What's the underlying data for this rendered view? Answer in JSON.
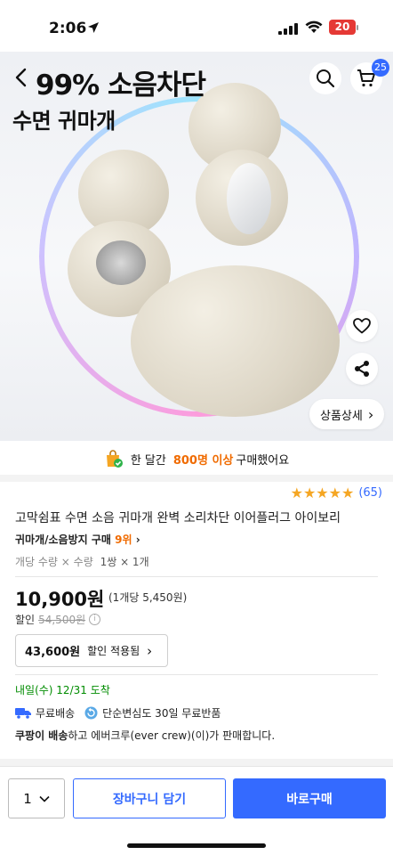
{
  "status_bar": {
    "time": "2:06",
    "battery": "20"
  },
  "hero": {
    "headline1": "99% 소음차단",
    "headline2": "수면 귀마개",
    "cart_count": "25",
    "detail_label": "상품상세",
    "detail_chevron": "›",
    "image_count": 8,
    "active_image_index": 0
  },
  "social_proof": {
    "prefix": "한 달간",
    "count": "800명 이상",
    "suffix": "구매했어요"
  },
  "rating": {
    "stars": 5,
    "count": "(65)",
    "star_color": "#f5a623"
  },
  "product": {
    "title": "고막쉼표 수면 소음 귀마개 완벽 소리차단 이어플러그 아이보리",
    "category": "귀마개/소음방지 구매",
    "rank": "9위",
    "rank_chevron": "›",
    "option_label": "개당 수량 × 수량",
    "option_value": "1쌍 × 1개"
  },
  "price": {
    "current": "10,900원",
    "unit": "(1개당 5,450원)",
    "discount_label": "할인",
    "original": "54,500원",
    "discount_amount": "43,600원",
    "discount_applied": "할인 적용됨",
    "discount_chevron": "›"
  },
  "shipping": {
    "delivery": "내일(수) 12/31 도착",
    "free_shipping": "무료배송",
    "free_return": "단순변심도 30일 무료반품",
    "seller_brand": "쿠팡이 배송",
    "seller_text": "하고 에버크루(ever crew)(이)가 판매합니다."
  },
  "bottom_bar": {
    "quantity": "1",
    "add_to_cart": "장바구니 담기",
    "buy_now": "바로구매"
  },
  "colors": {
    "accent": "#346aff",
    "highlight": "#f06b00",
    "delivery": "#008c00"
  }
}
